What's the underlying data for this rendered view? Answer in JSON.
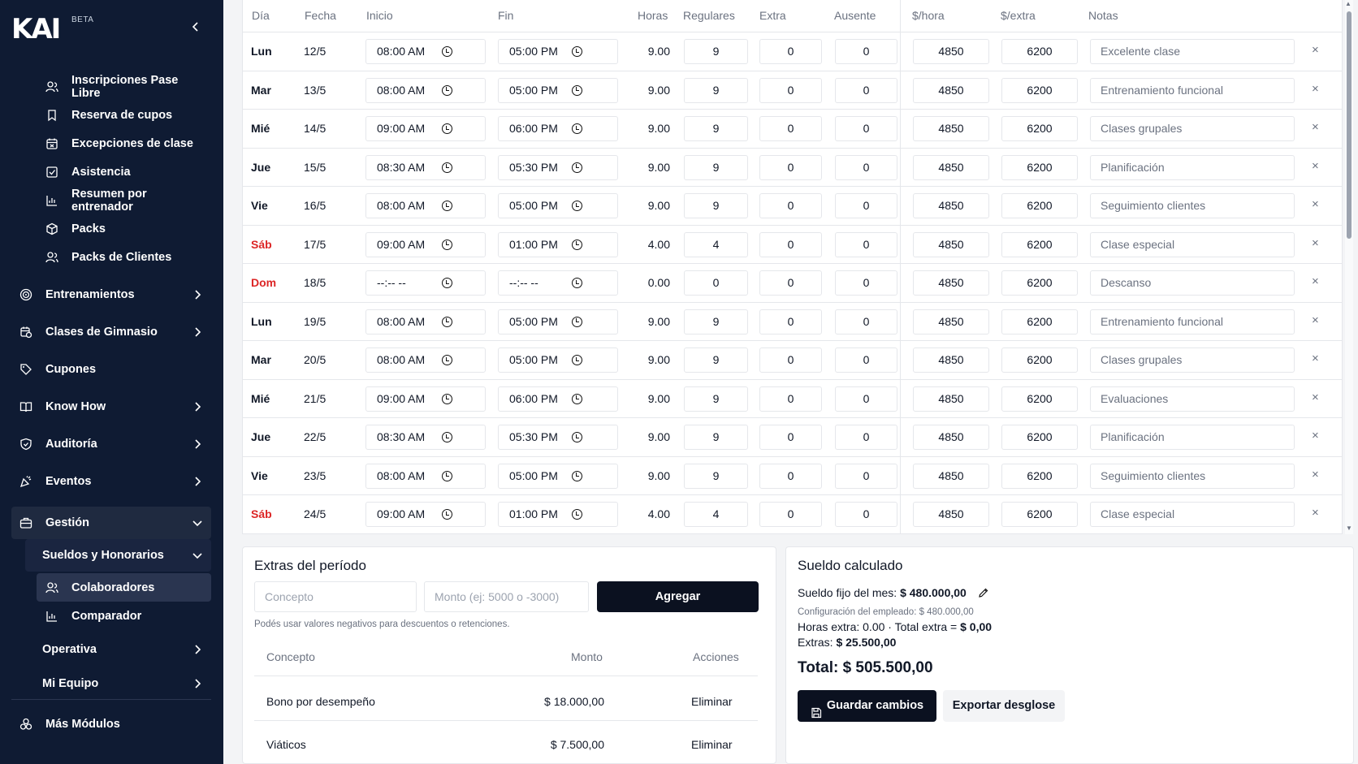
{
  "sidebar": {
    "logo": "KAI",
    "badge": "BETA",
    "items": [
      {
        "label": "Inscripciones Pase Libre"
      },
      {
        "label": "Reserva de cupos"
      },
      {
        "label": "Excepciones de clase"
      },
      {
        "label": "Asistencia"
      },
      {
        "label": "Resumen por entrenador"
      },
      {
        "label": "Packs"
      },
      {
        "label": "Packs de Clientes"
      },
      {
        "label": "Entrenamientos"
      },
      {
        "label": "Clases de Gimnasio"
      },
      {
        "label": "Cupones"
      },
      {
        "label": "Know How"
      },
      {
        "label": "Auditoría"
      },
      {
        "label": "Eventos"
      },
      {
        "label": "Gestión"
      },
      {
        "label": "Sueldos y Honorarios"
      },
      {
        "label": "Colaboradores"
      },
      {
        "label": "Comparador"
      },
      {
        "label": "Operativa"
      },
      {
        "label": "Mi Equipo"
      },
      {
        "label": "Más Módulos"
      }
    ]
  },
  "table": {
    "headers": [
      "Día",
      "Fecha",
      "Inicio",
      "Fin",
      "Horas",
      "Regulares",
      "Extra",
      "Ausente",
      "$/hora",
      "$/extra",
      "Notas"
    ],
    "rows": [
      {
        "day": "Lun",
        "date": "12/5",
        "start": "08:00 AM",
        "end": "05:00 PM",
        "hours": "9.00",
        "regular": "9",
        "extra": "0",
        "absent": "0",
        "rate": "4850",
        "extra_rate": "6200",
        "note": "Excelente clase",
        "weekend": false
      },
      {
        "day": "Mar",
        "date": "13/5",
        "start": "08:00 AM",
        "end": "05:00 PM",
        "hours": "9.00",
        "regular": "9",
        "extra": "0",
        "absent": "0",
        "rate": "4850",
        "extra_rate": "6200",
        "note": "Entrenamiento funcional",
        "weekend": false
      },
      {
        "day": "Mié",
        "date": "14/5",
        "start": "09:00 AM",
        "end": "06:00 PM",
        "hours": "9.00",
        "regular": "9",
        "extra": "0",
        "absent": "0",
        "rate": "4850",
        "extra_rate": "6200",
        "note": "Clases grupales",
        "weekend": false
      },
      {
        "day": "Jue",
        "date": "15/5",
        "start": "08:30 AM",
        "end": "05:30 PM",
        "hours": "9.00",
        "regular": "9",
        "extra": "0",
        "absent": "0",
        "rate": "4850",
        "extra_rate": "6200",
        "note": "Planificación",
        "weekend": false
      },
      {
        "day": "Vie",
        "date": "16/5",
        "start": "08:00 AM",
        "end": "05:00 PM",
        "hours": "9.00",
        "regular": "9",
        "extra": "0",
        "absent": "0",
        "rate": "4850",
        "extra_rate": "6200",
        "note": "Seguimiento clientes",
        "weekend": false
      },
      {
        "day": "Sáb",
        "date": "17/5",
        "start": "09:00 AM",
        "end": "01:00 PM",
        "hours": "4.00",
        "regular": "4",
        "extra": "0",
        "absent": "0",
        "rate": "4850",
        "extra_rate": "6200",
        "note": "Clase especial",
        "weekend": true
      },
      {
        "day": "Dom",
        "date": "18/5",
        "start": "--:-- --",
        "end": "--:-- --",
        "hours": "0.00",
        "regular": "0",
        "extra": "0",
        "absent": "0",
        "rate": "4850",
        "extra_rate": "6200",
        "note": "Descanso",
        "weekend": true
      },
      {
        "day": "Lun",
        "date": "19/5",
        "start": "08:00 AM",
        "end": "05:00 PM",
        "hours": "9.00",
        "regular": "9",
        "extra": "0",
        "absent": "0",
        "rate": "4850",
        "extra_rate": "6200",
        "note": "Entrenamiento funcional",
        "weekend": false
      },
      {
        "day": "Mar",
        "date": "20/5",
        "start": "08:00 AM",
        "end": "05:00 PM",
        "hours": "9.00",
        "regular": "9",
        "extra": "0",
        "absent": "0",
        "rate": "4850",
        "extra_rate": "6200",
        "note": "Clases grupales",
        "weekend": false
      },
      {
        "day": "Mié",
        "date": "21/5",
        "start": "09:00 AM",
        "end": "06:00 PM",
        "hours": "9.00",
        "regular": "9",
        "extra": "0",
        "absent": "0",
        "rate": "4850",
        "extra_rate": "6200",
        "note": "Evaluaciones",
        "weekend": false
      },
      {
        "day": "Jue",
        "date": "22/5",
        "start": "08:30 AM",
        "end": "05:30 PM",
        "hours": "9.00",
        "regular": "9",
        "extra": "0",
        "absent": "0",
        "rate": "4850",
        "extra_rate": "6200",
        "note": "Planificación",
        "weekend": false
      },
      {
        "day": "Vie",
        "date": "23/5",
        "start": "08:00 AM",
        "end": "05:00 PM",
        "hours": "9.00",
        "regular": "9",
        "extra": "0",
        "absent": "0",
        "rate": "4850",
        "extra_rate": "6200",
        "note": "Seguimiento clientes",
        "weekend": false
      },
      {
        "day": "Sáb",
        "date": "24/5",
        "start": "09:00 AM",
        "end": "01:00 PM",
        "hours": "4.00",
        "regular": "4",
        "extra": "0",
        "absent": "0",
        "rate": "4850",
        "extra_rate": "6200",
        "note": "Clase especial",
        "weekend": true
      }
    ],
    "delete_glyph": "×"
  },
  "extras": {
    "title": "Extras del período",
    "concept_placeholder": "Concepto",
    "amount_placeholder": "Monto (ej: 5000 o -3000)",
    "add_label": "Agregar",
    "hint": "Podés usar valores negativos para descuentos o retenciones.",
    "headers": {
      "concept": "Concepto",
      "amount": "Monto",
      "actions": "Acciones"
    },
    "items": [
      {
        "concept": "Bono por desempeño",
        "amount": "$ 18.000,00",
        "action": "Eliminar"
      },
      {
        "concept": "Viáticos",
        "amount": "$ 7.500,00",
        "action": "Eliminar"
      }
    ]
  },
  "sueldo": {
    "title": "Sueldo calculado",
    "fixed_label": "Sueldo fijo del mes:",
    "fixed_value": "$ 480.000,00",
    "config": "Configuración del empleado: $ 480.000,00",
    "extra_hours_label": "Horas extra: 0.00 · Total extra =",
    "extra_hours_value": "$ 0,00",
    "extras_label": "Extras:",
    "extras_value": "$ 25.500,00",
    "total": "Total: $ 505.500,00",
    "save_label": "Guardar cambios",
    "export_label": "Exportar desglose"
  },
  "colors": {
    "sidebar_bg": "#0f1b33",
    "weekend": "#dc2626",
    "primary_button": "#0b1120"
  }
}
